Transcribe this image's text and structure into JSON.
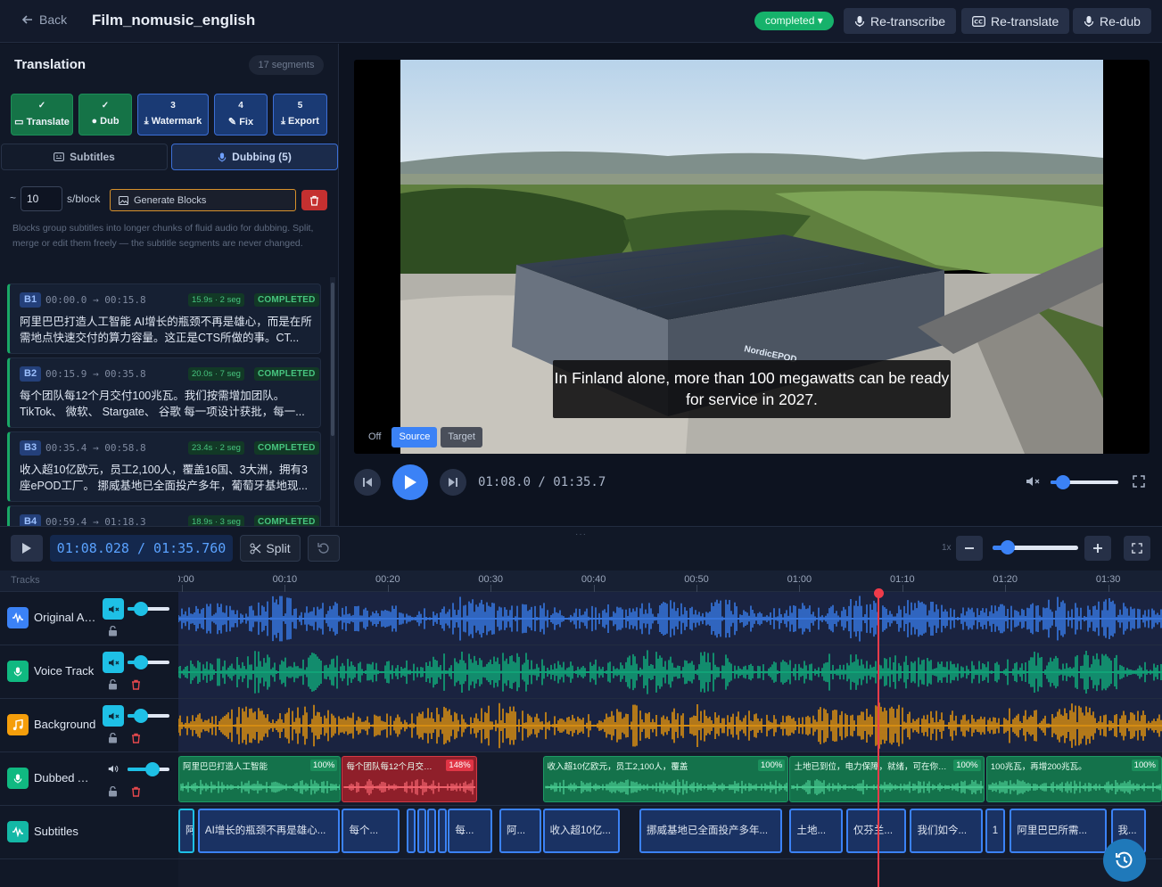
{
  "header": {
    "back_label": "Back",
    "title": "Film_nomusic_english",
    "status": "completed ▾",
    "buttons": [
      "Re-transcribe",
      "Re-translate",
      "Re-dub"
    ]
  },
  "panel": {
    "title": "Translation",
    "segment_count": "17 segments",
    "steps": [
      {
        "num": "✓",
        "label": "Translate",
        "state": "done"
      },
      {
        "num": "✓",
        "label": "Dub",
        "state": "done"
      },
      {
        "num": "3",
        "label": "Watermark",
        "state": "todo"
      },
      {
        "num": "4",
        "label": "Fix",
        "state": "todo"
      },
      {
        "num": "5",
        "label": "Export",
        "state": "todo"
      }
    ],
    "tabs": {
      "subtitles": "Subtitles",
      "dubbing": "Dubbing (5)"
    },
    "tilde": "~",
    "seconds_value": "10",
    "seconds_label": "s/block",
    "generate_label": "Generate Blocks",
    "help_text": "Blocks group subtitles into longer chunks of fluid audio for dubbing. Split, merge or edit them freely — the subtitle segments are never changed.",
    "blocks": [
      {
        "id": "B1",
        "time": "00:00.0 → 00:15.8",
        "seg": "15.9s · 2 seg",
        "status": "COMPLETED",
        "text": "阿里巴巴打造人工智能 AI增长的瓶颈不再是雄心，而是在所需地点快速交付的算力容量。这正是CTS所做的事。CT..."
      },
      {
        "id": "B2",
        "time": "00:15.9 → 00:35.8",
        "seg": "20.0s · 7 seg",
        "status": "COMPLETED",
        "text": "每个团队每12个月交付100兆瓦。我们按需增加团队。TikTok、 微软、 Stargate、 谷歌 每一项设计获批，每一..."
      },
      {
        "id": "B3",
        "time": "00:35.4 → 00:58.8",
        "seg": "23.4s · 2 seg",
        "status": "COMPLETED",
        "text": "收入超10亿欧元，员工2,100人，覆盖16国、3大洲，拥有3座ePOD工厂。 挪威基地已全面投产多年，葡萄牙基地现..."
      },
      {
        "id": "B4",
        "time": "00:59.4 → 01:18.3",
        "seg": "18.9s · 3 seg",
        "status": "COMPLETED",
        "text": ""
      }
    ]
  },
  "video": {
    "caption": "In Finland alone, more than 100 megawatts can be ready for service in 2027.",
    "building_label": "NordicEPOD",
    "subtitle_modes": [
      "Off",
      "Source",
      "Target"
    ],
    "active_mode": "Source",
    "time": "01:08.0 / 01:35.7",
    "volume_fraction": 0.18
  },
  "timeline": {
    "handle": "···",
    "time": "01:08.028 / 01:35.760",
    "split_label": "Split",
    "zoom_label": "1x",
    "tracks_label": "Tracks",
    "duration_s": 95.76,
    "current_s": 68.028,
    "ruler": [
      {
        "t": 0,
        "label": "00:00"
      },
      {
        "t": 10,
        "label": "00:10"
      },
      {
        "t": 20,
        "label": "00:20"
      },
      {
        "t": 30,
        "label": "00:30"
      },
      {
        "t": 40,
        "label": "00:40"
      },
      {
        "t": 50,
        "label": "00:50"
      },
      {
        "t": 60,
        "label": "01:00"
      },
      {
        "t": 70,
        "label": "01:10"
      },
      {
        "t": 80,
        "label": "01:20"
      },
      {
        "t": 90,
        "label": "01:30"
      }
    ],
    "tracks": [
      {
        "name": "Original Audio",
        "icon": "waveform-icon",
        "color": "#3b82f6",
        "muted": true,
        "deletable": false
      },
      {
        "name": "Voice Track",
        "icon": "microphone-icon",
        "color": "#10b981",
        "muted": true,
        "deletable": true
      },
      {
        "name": "Background",
        "icon": "music-note-icon",
        "color": "#f59e0b",
        "muted": true,
        "deletable": true
      },
      {
        "name": "Dubbed Audio",
        "icon": "microphone-icon",
        "color": "#10b981",
        "muted": false,
        "deletable": true
      },
      {
        "name": "Subtitles",
        "icon": "subtitle-wave-icon",
        "color": "#14b8a6",
        "muted": false,
        "deletable": false
      }
    ],
    "dub_clips": [
      {
        "text": "阿里巴巴打造人工智能",
        "pct": "100%",
        "state": "ok",
        "start": 0.0,
        "end": 15.8
      },
      {
        "text": "每个团队每12个月交付100...",
        "pct": "148%",
        "state": "over",
        "start": 15.9,
        "end": 29.0
      },
      {
        "text": "收入超10亿欧元，员工2,100人，覆盖",
        "pct": "100%",
        "state": "ok",
        "start": 35.4,
        "end": 59.3
      },
      {
        "text": "土地已到位，电力保障，就绪，可在你准备...",
        "pct": "100%",
        "state": "ok",
        "start": 59.4,
        "end": 78.3
      },
      {
        "text": "100兆瓦，再增200兆瓦。",
        "pct": "100%",
        "state": "ok",
        "start": 78.5,
        "end": 95.76
      }
    ],
    "subtitles": [
      {
        "text": "阿...",
        "start": 0.0,
        "end": 1.6
      },
      {
        "text": "AI增长的瓶颈不再是雄心...",
        "start": 1.9,
        "end": 15.7
      },
      {
        "text": "每个...",
        "start": 15.9,
        "end": 21.5
      },
      {
        "text": "",
        "start": 22.2,
        "end": 23.0
      },
      {
        "text": "",
        "start": 23.2,
        "end": 24.0
      },
      {
        "text": "",
        "start": 24.2,
        "end": 25.0
      },
      {
        "text": "",
        "start": 25.2,
        "end": 26.0
      },
      {
        "text": "每...",
        "start": 26.2,
        "end": 30.5
      },
      {
        "text": "阿...",
        "start": 31.2,
        "end": 35.3
      },
      {
        "text": "收入超10亿...",
        "start": 35.4,
        "end": 42.9
      },
      {
        "text": "挪威基地已全面投产多年...",
        "start": 44.8,
        "end": 58.7
      },
      {
        "text": "土地...",
        "start": 59.4,
        "end": 64.6
      },
      {
        "text": "仅芬兰...",
        "start": 64.9,
        "end": 70.7
      },
      {
        "text": "我们如今...",
        "start": 71.1,
        "end": 78.2
      },
      {
        "text": "1",
        "start": 78.4,
        "end": 80.3
      },
      {
        "text": "阿里巴巴所需...",
        "start": 80.8,
        "end": 90.2
      },
      {
        "text": "我...",
        "start": 90.6,
        "end": 94.0
      }
    ]
  }
}
